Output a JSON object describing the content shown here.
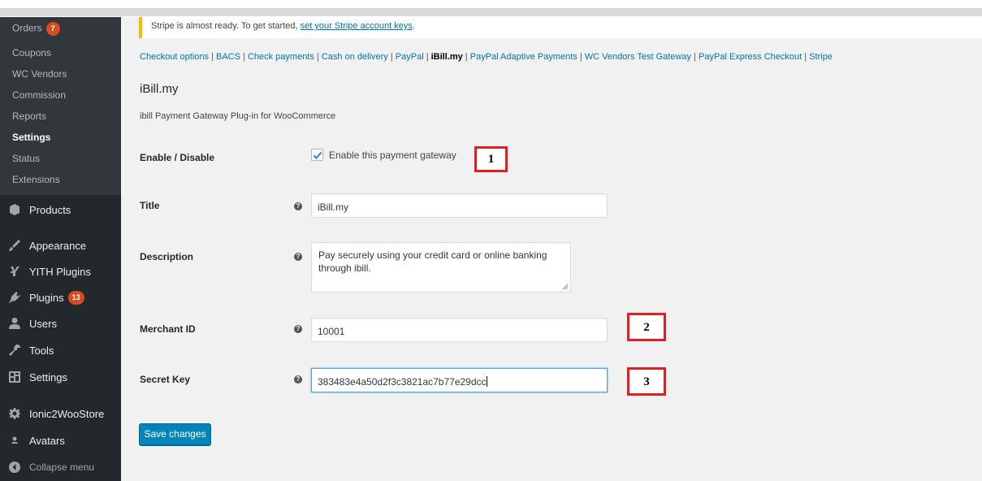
{
  "sidebar": {
    "submenu": [
      {
        "label": "Orders",
        "badge": "7"
      },
      {
        "label": "Coupons"
      },
      {
        "label": "WC Vendors"
      },
      {
        "label": "Commission"
      },
      {
        "label": "Reports"
      },
      {
        "label": "Settings",
        "current": true
      },
      {
        "label": "Status"
      },
      {
        "label": "Extensions"
      }
    ],
    "menu": [
      {
        "label": "Products",
        "icon": "products-icon"
      },
      {
        "label": "Appearance",
        "icon": "appearance-icon"
      },
      {
        "label": "YITH Plugins",
        "icon": "yith-icon"
      },
      {
        "label": "Plugins",
        "icon": "plugins-icon",
        "badge": "13"
      },
      {
        "label": "Users",
        "icon": "users-icon"
      },
      {
        "label": "Tools",
        "icon": "tools-icon"
      },
      {
        "label": "Settings",
        "icon": "settings-icon"
      },
      {
        "label": "Ionic2WooStore",
        "icon": "gear-icon"
      },
      {
        "label": "Avatars",
        "icon": "avatar-icon"
      }
    ],
    "collapse_label": "Collapse menu"
  },
  "notice": {
    "text": "Stripe is almost ready. To get started, ",
    "link": "set your Stripe account keys",
    "suffix": "."
  },
  "tabs": [
    "Checkout options",
    "BACS",
    "Check payments",
    "Cash on delivery",
    "PayPal",
    "iBill.my",
    "PayPal Adaptive Payments",
    "WC Vendors Test Gateway",
    "PayPal Express Checkout",
    "Stripe"
  ],
  "current_tab": "iBill.my",
  "section": {
    "title": "iBill.my",
    "description": "ibill Payment Gateway Plug-in for WooCommerce"
  },
  "fields": {
    "enable": {
      "label": "Enable / Disable",
      "checkbox_label": "Enable this payment gateway",
      "checked": true
    },
    "title": {
      "label": "Title",
      "value": "iBill.my"
    },
    "description": {
      "label": "Description",
      "line1": "Pay securely using your credit card or online banking",
      "line2": "through ibill."
    },
    "merchant_id": {
      "label": "Merchant ID",
      "value": "10001"
    },
    "secret_key": {
      "label": "Secret Key",
      "value": "383483e4a50d2f3c3821ac7b77e29dcc"
    }
  },
  "annotations": [
    "1",
    "2",
    "3"
  ],
  "save_label": "Save changes",
  "colors": {
    "sidebar": "#23282d",
    "submenu": "#32373c",
    "link": "#0073aa",
    "button": "#0085ba",
    "badge": "#d54e21",
    "annotation": "#e02020"
  }
}
